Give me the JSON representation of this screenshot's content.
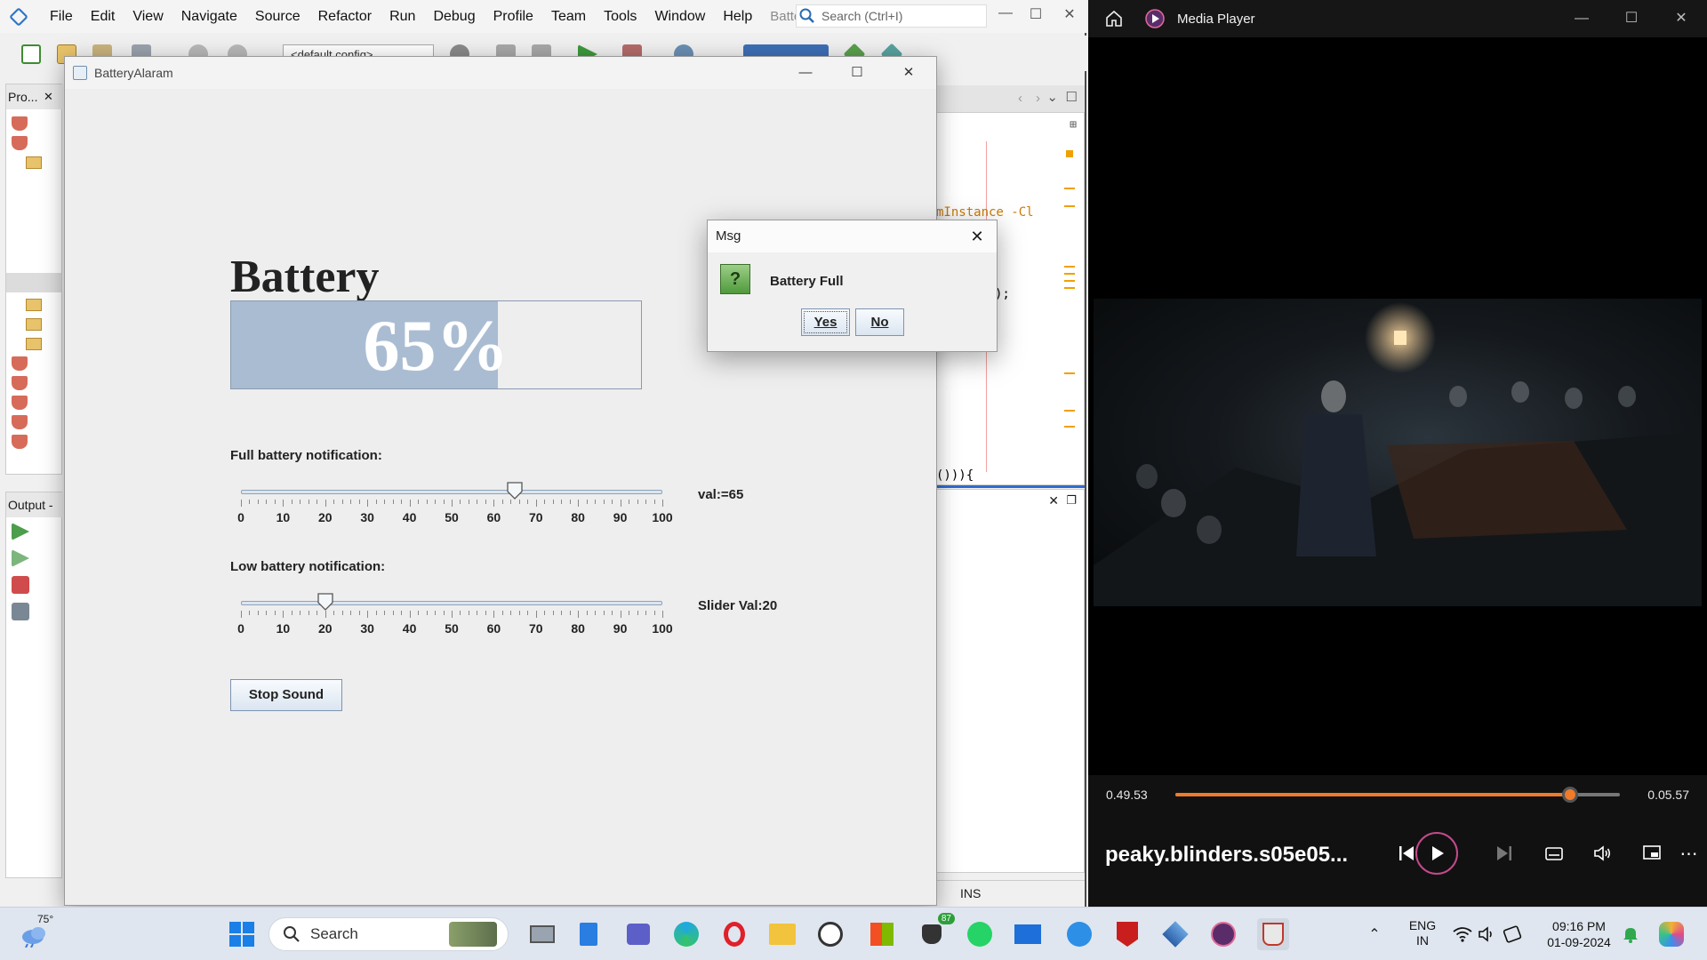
{
  "ide": {
    "menu": [
      "File",
      "Edit",
      "View",
      "Navigate",
      "Source",
      "Refactor",
      "Run",
      "Debug",
      "Profile",
      "Team",
      "Tools",
      "Window",
      "Help"
    ],
    "project_hint": "Batte...",
    "search_placeholder": "Search (Ctrl+I)",
    "config_select": "<default config>",
    "projects_tab": "Pro...",
    "output_tab": "Output -",
    "code_fragment_1": "mInstance -Cl",
    "code_fragment_2": ");",
    "code_fragment_3": "())){",
    "status_ins": "INS"
  },
  "battery_window": {
    "title": "BatteryAlaram",
    "heading": "Battery",
    "percent_text": "65%",
    "percent_value": 65,
    "full_label": "Full battery notification:",
    "full_slider_value": 65,
    "full_value_text": "val:=65",
    "low_label": "Low battery notification:",
    "low_slider_value": 20,
    "low_value_text": "Slider Val:20",
    "tick_labels": [
      "0",
      "10",
      "20",
      "30",
      "40",
      "50",
      "60",
      "70",
      "80",
      "90",
      "100"
    ],
    "stop_button": "Stop Sound"
  },
  "dialog": {
    "title": "Msg",
    "message": "Battery Full",
    "yes_label": "Yes",
    "no_label": "No"
  },
  "media_player": {
    "title": "Media Player",
    "time_current": "0.49.53",
    "time_end": "0.05.57",
    "progress_fraction": 0.887,
    "filename": "peaky.blinders.s05e05...",
    "accent_color": "#f07b2a"
  },
  "taskbar": {
    "weather_temp": "75°",
    "search_label": "Search",
    "badge_count": "87",
    "lang_line1": "ENG",
    "lang_line2": "IN",
    "time": "09:16 PM",
    "date": "01-09-2024"
  }
}
